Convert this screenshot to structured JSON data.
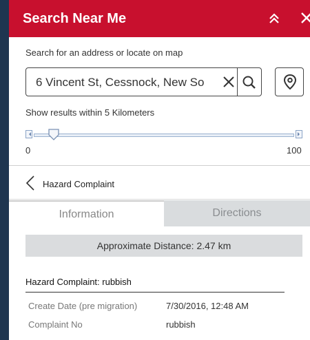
{
  "header": {
    "title": "Search Near Me",
    "collapse_icon": "double-chevron-up-icon",
    "close_icon": "close-icon",
    "color": "#c8102e"
  },
  "search": {
    "label": "Search for an address or locate on map",
    "value": "6 Vincent St, Cessnock, New So",
    "clear_icon": "close-icon",
    "search_icon": "search-icon",
    "locate_icon": "location-pin-icon"
  },
  "radius": {
    "label": "Show results within 5 Kilometers",
    "value": 5,
    "min": "0",
    "max": "100"
  },
  "back": {
    "label": "Hazard Complaint"
  },
  "tabs": [
    {
      "label": "Information",
      "active": true
    },
    {
      "label": "Directions",
      "active": false
    }
  ],
  "detail": {
    "distance": "Approximate Distance: 2.47 km",
    "feature_title": "Hazard Complaint: rubbish",
    "fields": [
      {
        "label": "Create Date (pre migration)",
        "value": "7/30/2016, 12:48 AM"
      },
      {
        "label": "Complaint No",
        "value": "rubbish"
      }
    ]
  }
}
